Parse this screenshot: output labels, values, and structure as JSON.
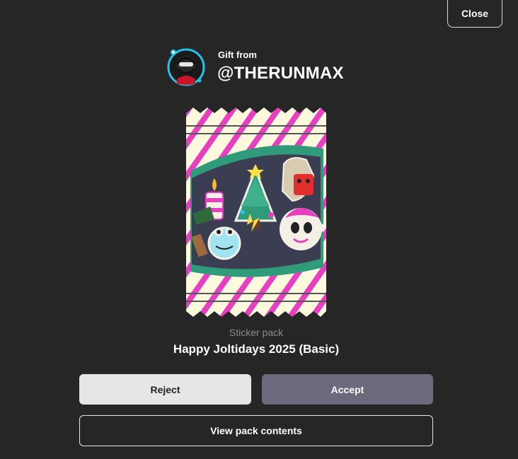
{
  "header": {
    "close_label": "Close"
  },
  "gift": {
    "from_label": "Gift from",
    "sender": "@THERUNMAX"
  },
  "pack": {
    "type_label": "Sticker pack",
    "name": "Happy Joltidays 2025 (Basic)",
    "art_icon": "sticker-pack-wrapper-icon"
  },
  "actions": {
    "reject_label": "Reject",
    "accept_label": "Accept",
    "view_contents_label": "View pack contents"
  },
  "colors": {
    "background": "#262626",
    "accept_button": "#6a6a7c",
    "reject_button": "#e6e6e6",
    "muted_text": "#8c8c8c",
    "wrapper_stripe": "#e83fc0",
    "wrapper_base": "#fdf9dc",
    "wrapper_band": "#2f9b7b"
  }
}
